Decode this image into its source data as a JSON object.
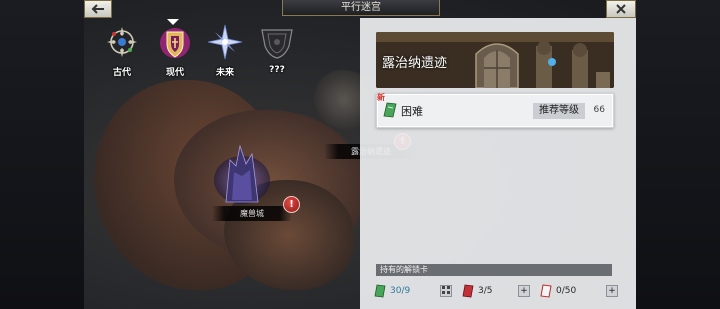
{
  "header": {
    "title": "平行迷宫"
  },
  "eras": [
    {
      "label": "古代",
      "selected": false
    },
    {
      "label": "现代",
      "selected": true
    },
    {
      "label": "未来",
      "selected": false
    },
    {
      "label": "???",
      "selected": false
    }
  ],
  "map": {
    "locations": [
      {
        "label": "露治纳遗迹",
        "alert": "!"
      },
      {
        "label": "魔兽城",
        "alert": "!"
      }
    ]
  },
  "panel": {
    "title": "露治纳遗迹",
    "new_badge": "新",
    "difficulty": "困难",
    "recommend_label": "推荐等级",
    "recommend_level": "66",
    "cards_header": "持有的解锁卡",
    "cards": [
      {
        "value": "30/9",
        "color": "#3aa04a"
      },
      {
        "value": "3/5",
        "color": "#c4303a"
      },
      {
        "value": "0/50",
        "color": "#d9d9d9"
      }
    ]
  },
  "colors": {
    "accent": "#8a7a52",
    "alert": "#d6352e"
  }
}
